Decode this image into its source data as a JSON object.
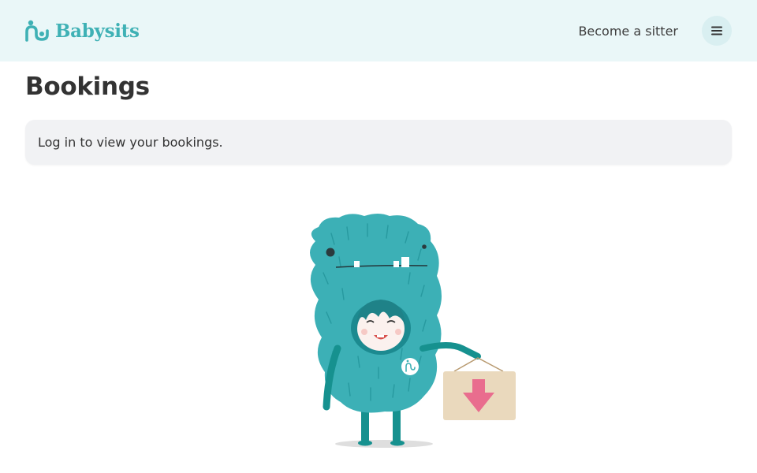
{
  "header": {
    "brand": "Babysits",
    "become_sitter_label": "Become a sitter",
    "menu_icon": "hamburger-menu-icon"
  },
  "main": {
    "title": "Bookings",
    "notice_text": "Log in to view your bookings."
  },
  "illustration": {
    "subject": "monster-with-sign-icon"
  },
  "colors": {
    "brand": "#3fb1b5",
    "header_bg": "#eaf7f8",
    "notice_bg": "#f1f2f4",
    "monster": "#3cb0b6",
    "sign": "#ead9bd",
    "arrow": "#e96d8e"
  }
}
